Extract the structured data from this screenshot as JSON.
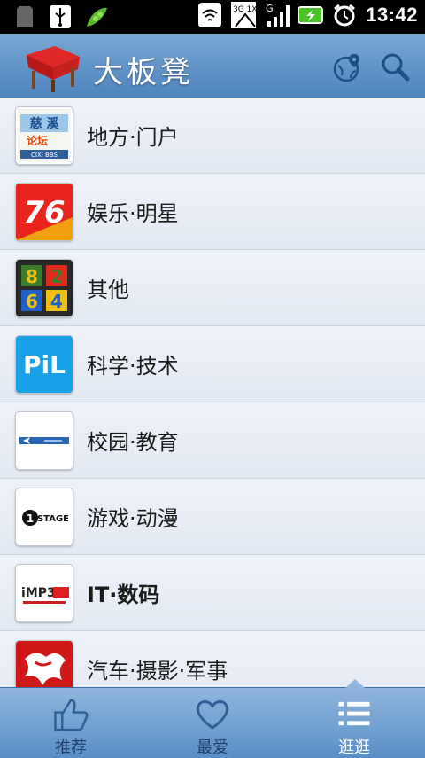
{
  "status": {
    "time": "13:42",
    "net_label": "3G 1X",
    "signal_label": "G"
  },
  "header": {
    "title": "大板凳"
  },
  "categories": [
    {
      "label": "地方·门户",
      "thumb": "慈溪论坛"
    },
    {
      "label": "娱乐·明星",
      "thumb": "76"
    },
    {
      "label": "其他",
      "thumb": "8264"
    },
    {
      "label": "科学·技术",
      "thumb": "PiL"
    },
    {
      "label": "校园·教育",
      "thumb": ""
    },
    {
      "label": "游戏·动漫",
      "thumb": "STAGE"
    },
    {
      "label": "IT·数码",
      "thumb": "iMP3"
    },
    {
      "label": "汽车·摄影·军事",
      "thumb": ""
    }
  ],
  "tabs": [
    {
      "label": "推荐",
      "icon": "thumbs-up-icon"
    },
    {
      "label": "最爱",
      "icon": "heart-icon"
    },
    {
      "label": "逛逛",
      "icon": "list-icon"
    }
  ],
  "colors": {
    "header": "#5b8ec6",
    "active_tab_label": "#ffffff"
  }
}
